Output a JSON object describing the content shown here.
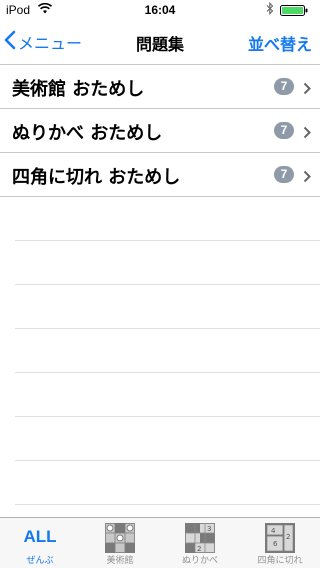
{
  "status_bar": {
    "carrier": "iPod",
    "time": "16:04"
  },
  "nav": {
    "back_label": "メニュー",
    "title": "問題集",
    "right_label": "並べ替え"
  },
  "list": {
    "items": [
      {
        "title": "美術館 おためし",
        "count": "7"
      },
      {
        "title": "ぬりかべ おためし",
        "count": "7"
      },
      {
        "title": "四角に切れ おためし",
        "count": "7"
      }
    ]
  },
  "tabbar": {
    "tabs": [
      {
        "icon_text": "ALL",
        "label": "ぜんぶ",
        "active": true
      },
      {
        "label": "美術館",
        "icon": "bijutsukan-grid-icon"
      },
      {
        "label": "ぬりかべ",
        "icon": "nurikabe-grid-icon"
      },
      {
        "label": "四角に切れ",
        "icon": "shikaku-grid-icon"
      }
    ]
  },
  "colors": {
    "accent": "#1478f0",
    "badge": "#8e9aa8",
    "separator": "#c8c7cc",
    "tab_inactive": "#929292"
  }
}
